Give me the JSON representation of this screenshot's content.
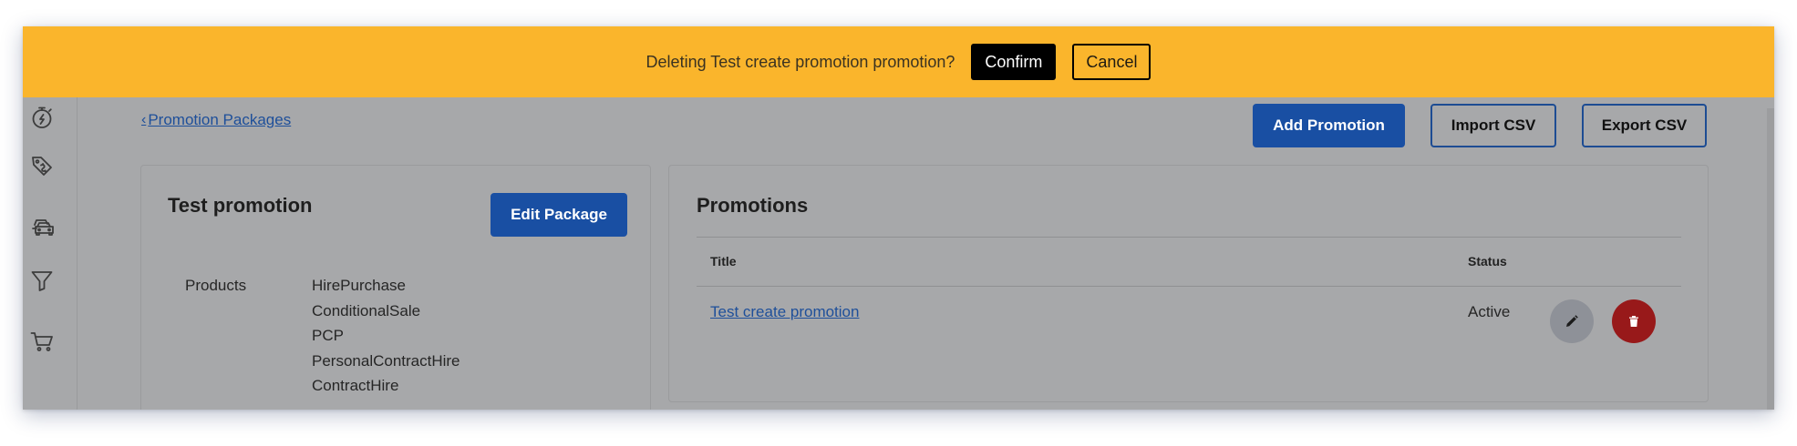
{
  "banner": {
    "message": "Deleting Test create promotion promotion?",
    "confirm_label": "Confirm",
    "cancel_label": "Cancel"
  },
  "sidebar": {
    "icons": [
      "stopwatch-icon",
      "tags-icon",
      "cars-icon",
      "funnel-icon",
      "shopping-cart-icon"
    ]
  },
  "breadcrumb": {
    "back_label": "Promotion Packages"
  },
  "toolbar": {
    "add_label": "Add Promotion",
    "import_label": "Import CSV",
    "export_label": "Export CSV"
  },
  "package": {
    "title": "Test promotion",
    "edit_label": "Edit Package",
    "products_label": "Products",
    "products": [
      "HirePurchase",
      "ConditionalSale",
      "PCP",
      "PersonalContractHire",
      "ContractHire"
    ]
  },
  "promotions": {
    "title": "Promotions",
    "columns": {
      "title": "Title",
      "status": "Status"
    },
    "rows": [
      {
        "title": "Test create promotion",
        "status": "Active"
      }
    ]
  },
  "colors": {
    "banner": "#fab52c",
    "primary": "#194fa3",
    "delete": "#98191a",
    "overlay_background": "#a7a8aa"
  }
}
